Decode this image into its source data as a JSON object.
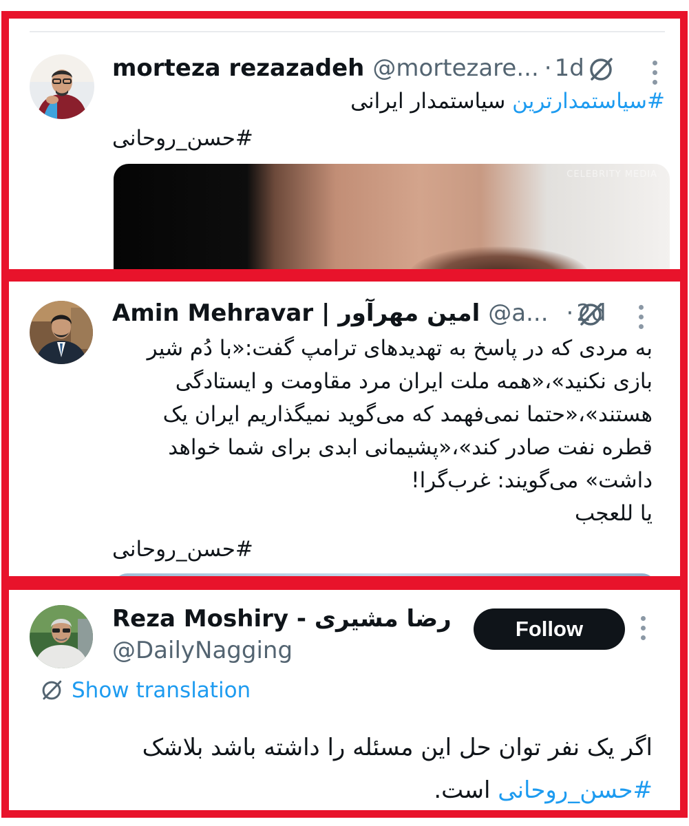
{
  "tweets": [
    {
      "author": "morteza rezazadeh",
      "handle": "@mortezare...",
      "separator": "·",
      "time": "1d",
      "line1_hashtag": "#سیاستمدارترین",
      "line1_text": " سیاستمدار ایرانی",
      "hashtag": "#حسن_روحانی",
      "media_watermark": "CELEBRITY MEDIA"
    },
    {
      "author": "Amin Mehravar | امین مهرآور",
      "handle": "@a...",
      "separator": "·",
      "time": "2d",
      "lines": [
        "به مردی که در پاسخ به تهدیدهای ترامپ گفت:«با دُم شیر",
        "بازی نکنید»،«همه ملت ایران مرد مقاومت و ایستادگی",
        "هستند»،«حتما نمی‌فهمد که می‌گوید نمیگذاریم ایران یک",
        "قطره نفت صادر کند»،«پشیمانی ابدی برای شما خواهد",
        "داشت» می‌گویند: غرب‌گرا!",
        "یا للعجب"
      ],
      "hashtag": "#حسن_روحانی"
    },
    {
      "author": "Reza Moshiry - رضا مشیری",
      "handle": "@DailyNagging",
      "follow_label": "Follow",
      "show_translation": "Show translation",
      "line1": "اگر یک نفر توان حل این مسئله را داشته باشد بلاشک",
      "hashtag": "#حسن_روحانی",
      "line2_tail": " است."
    }
  ],
  "colors": {
    "frame": "#e8132b",
    "link": "#1d9bf0",
    "text": "#0f1419",
    "muted": "#536471",
    "button": "#0f1419"
  },
  "icons": [
    "grok-icon",
    "more-options-icon",
    "translate-icon"
  ]
}
